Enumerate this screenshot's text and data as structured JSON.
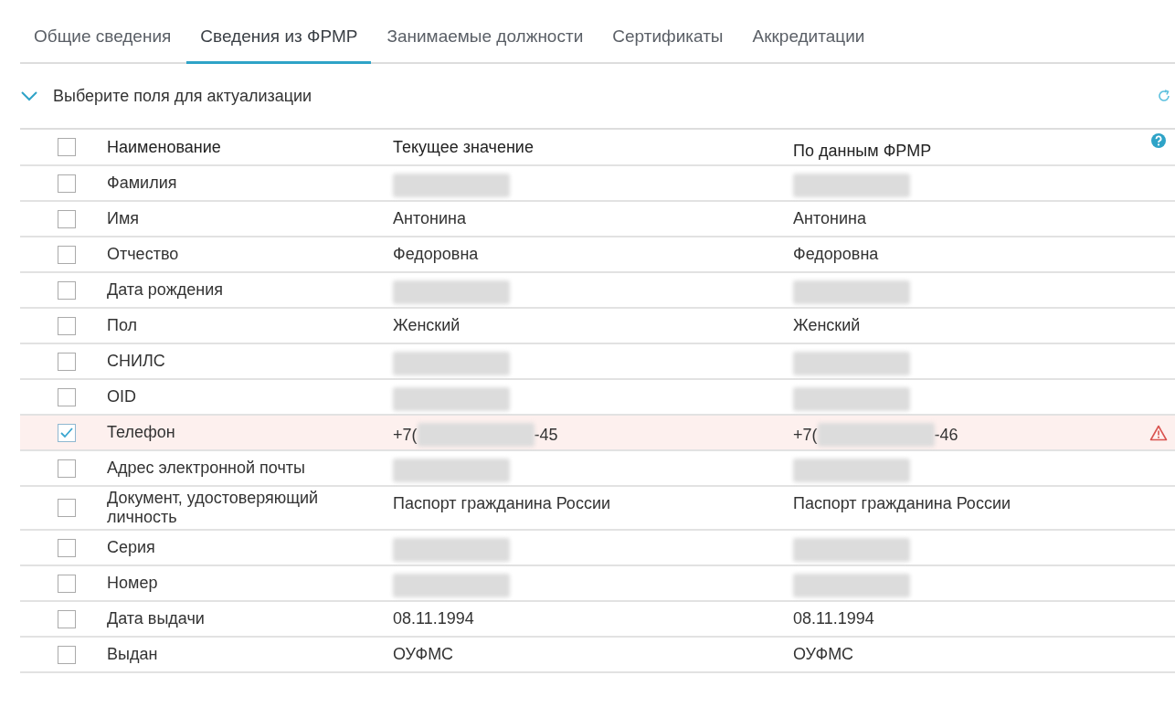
{
  "tabs": [
    {
      "label": "Общие сведения",
      "selected": false
    },
    {
      "label": "Сведения из ФРМР",
      "selected": true
    },
    {
      "label": "Занимаемые должности",
      "selected": false
    },
    {
      "label": "Сертификаты",
      "selected": false
    },
    {
      "label": "Аккредитации",
      "selected": false
    }
  ],
  "section": {
    "title": "Выберите поля для актуализации",
    "expanded": true
  },
  "table": {
    "columns": [
      "Наименование",
      "Текущее значение",
      "По данным ФРМР"
    ],
    "header_checked": false,
    "rows": [
      {
        "name": "Фамилия",
        "checked": false,
        "warning": false,
        "current": [
          {
            "kind": "redacted"
          }
        ],
        "frmr": [
          {
            "kind": "redacted"
          }
        ]
      },
      {
        "name": "Имя",
        "checked": false,
        "warning": false,
        "current": [
          {
            "kind": "text",
            "text": "Антонина"
          }
        ],
        "frmr": [
          {
            "kind": "text",
            "text": "Антонина"
          }
        ]
      },
      {
        "name": "Отчество",
        "checked": false,
        "warning": false,
        "current": [
          {
            "kind": "text",
            "text": "Федоровна"
          }
        ],
        "frmr": [
          {
            "kind": "text",
            "text": "Федоровна"
          }
        ]
      },
      {
        "name": "Дата рождения",
        "checked": false,
        "warning": false,
        "current": [
          {
            "kind": "redacted"
          }
        ],
        "frmr": [
          {
            "kind": "redacted"
          }
        ]
      },
      {
        "name": "Пол",
        "checked": false,
        "warning": false,
        "current": [
          {
            "kind": "text",
            "text": "Женский"
          }
        ],
        "frmr": [
          {
            "kind": "text",
            "text": "Женский"
          }
        ]
      },
      {
        "name": "СНИЛС",
        "checked": false,
        "warning": false,
        "current": [
          {
            "kind": "redacted"
          }
        ],
        "frmr": [
          {
            "kind": "redacted"
          }
        ]
      },
      {
        "name": "OID",
        "checked": false,
        "warning": false,
        "current": [
          {
            "kind": "redacted"
          }
        ],
        "frmr": [
          {
            "kind": "redacted"
          }
        ]
      },
      {
        "name": "Телефон",
        "checked": true,
        "warning": true,
        "current": [
          {
            "kind": "text",
            "text": "+7("
          },
          {
            "kind": "redacted"
          },
          {
            "kind": "text",
            "text": "-45"
          }
        ],
        "frmr": [
          {
            "kind": "text",
            "text": "+7("
          },
          {
            "kind": "redacted"
          },
          {
            "kind": "text",
            "text": "-46"
          }
        ]
      },
      {
        "name": "Адрес электронной почты",
        "checked": false,
        "warning": false,
        "current": [
          {
            "kind": "redacted"
          }
        ],
        "frmr": [
          {
            "kind": "redacted"
          }
        ]
      },
      {
        "name": "Документ, удостоверяющий личность",
        "checked": false,
        "warning": false,
        "current": [
          {
            "kind": "text",
            "text": "Паспорт гражданина России"
          }
        ],
        "frmr": [
          {
            "kind": "text",
            "text": "Паспорт гражданина России"
          }
        ]
      },
      {
        "name": "Серия",
        "checked": false,
        "warning": false,
        "current": [
          {
            "kind": "redacted"
          }
        ],
        "frmr": [
          {
            "kind": "redacted"
          }
        ]
      },
      {
        "name": "Номер",
        "checked": false,
        "warning": false,
        "current": [
          {
            "kind": "redacted"
          }
        ],
        "frmr": [
          {
            "kind": "redacted"
          }
        ]
      },
      {
        "name": "Дата выдачи",
        "checked": false,
        "warning": false,
        "current": [
          {
            "kind": "text",
            "text": "08.11.1994"
          }
        ],
        "frmr": [
          {
            "kind": "text",
            "text": "08.11.1994"
          }
        ]
      },
      {
        "name": "Выдан",
        "checked": false,
        "warning": false,
        "current": [
          {
            "kind": "text",
            "text": "ОУФМС"
          }
        ],
        "frmr": [
          {
            "kind": "text",
            "text": "ОУФМС"
          }
        ]
      }
    ]
  }
}
